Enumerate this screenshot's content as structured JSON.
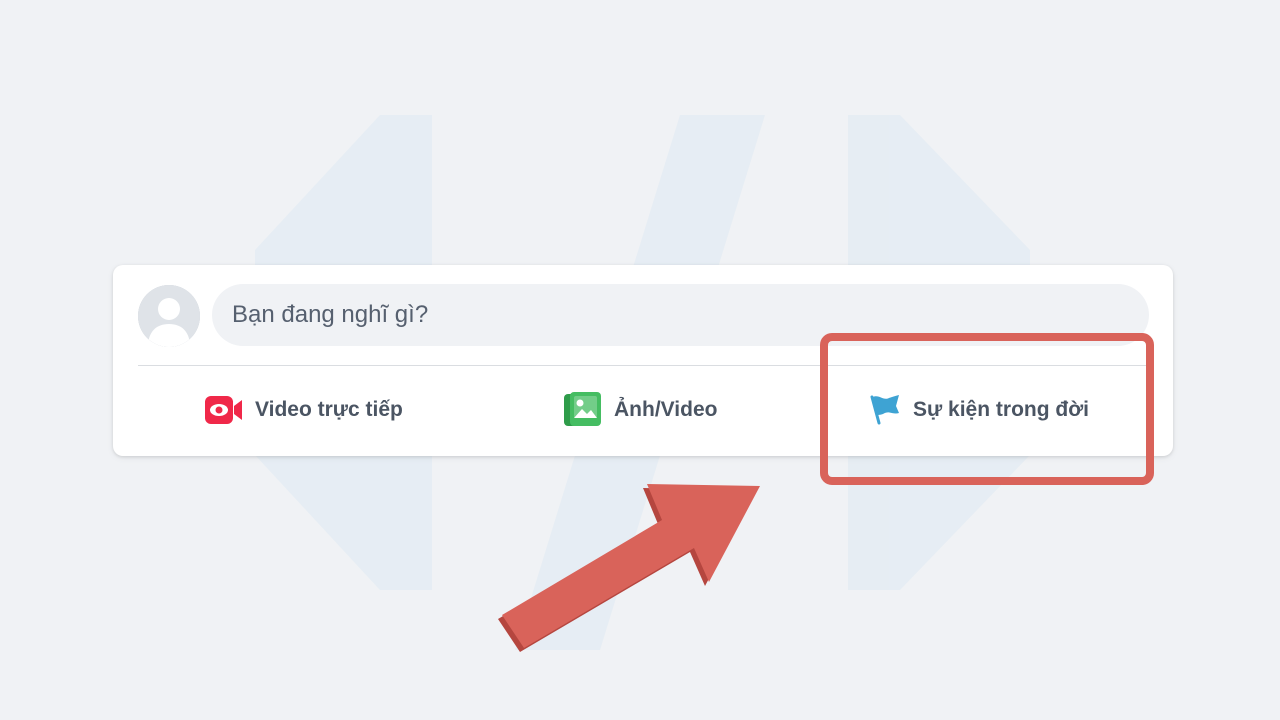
{
  "composer": {
    "avatar_icon": "default-user-avatar",
    "prompt_placeholder": "Bạn đang nghĩ gì?",
    "actions": [
      {
        "label": "Video trực tiếp",
        "icon": "live-video-icon",
        "color": "#f02849"
      },
      {
        "label": "Ảnh/Video",
        "icon": "photo-video-icon",
        "color": "#45bd62"
      },
      {
        "label": "Sự kiện trong đời",
        "icon": "life-event-flag-icon",
        "color": "#3ea3d3"
      }
    ]
  },
  "annotation": {
    "highlight_color": "#d9635a",
    "arrow_color": "#d9635a",
    "highlighted_item": "Sự kiện trong đời"
  }
}
